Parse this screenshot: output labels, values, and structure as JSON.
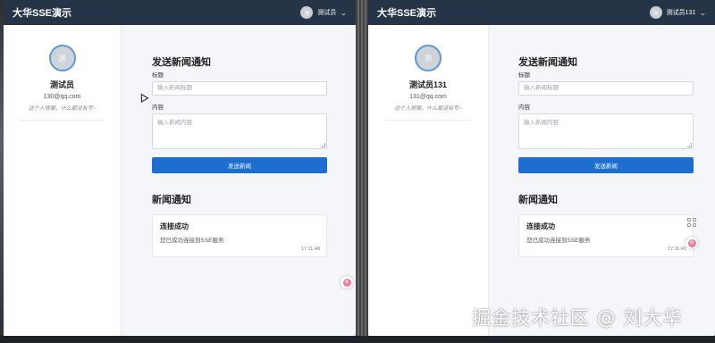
{
  "left_window": {
    "app_title": "大华SSE演示",
    "header_user": "测试员",
    "avatar_initial": "测",
    "profile": {
      "name": "测试员",
      "email": "130@qq.com",
      "signature": "这个人很懒，什么都没有写~"
    },
    "send_section": {
      "title": "发送新闻通知",
      "label_title": "标题",
      "title_placeholder": "输入新闻标题",
      "label_content": "内容",
      "content_placeholder": "输入新闻内容",
      "send_button": "发送新闻"
    },
    "news_section": {
      "title": "新闻通知",
      "notice": {
        "title": "连接成功",
        "body": "您已成功连接到SSE服务",
        "time": "17:11:40"
      }
    }
  },
  "right_window": {
    "app_title": "大华SSE演示",
    "header_user": "测试员131",
    "avatar_initial": "测",
    "profile": {
      "name": "测试员131",
      "email": "131@qq.com",
      "signature": "这个人很懒，什么都没有写~"
    },
    "send_section": {
      "title": "发送新闻通知",
      "label_title": "标题",
      "title_placeholder": "输入新闻标题",
      "label_content": "内容",
      "content_placeholder": "输入新闻内容",
      "send_button": "发送新闻"
    },
    "news_section": {
      "title": "新闻通知",
      "notice": {
        "title": "连接成功",
        "body": "您已成功连接到SSE服务",
        "time": "17:11:41"
      }
    }
  },
  "watermark": "掘金技术社区 @ 刘大华",
  "colors": {
    "header": "#253447",
    "primary_button": "#1e6dd0",
    "avatar_border": "#5b9ad6"
  }
}
